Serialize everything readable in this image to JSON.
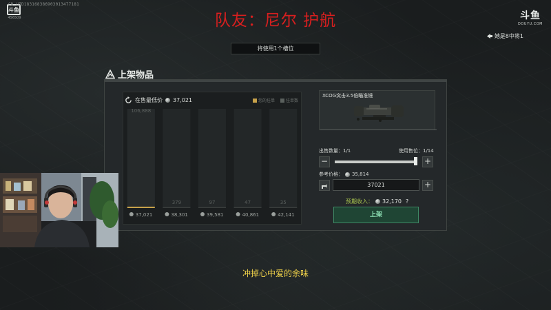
{
  "overlay": {
    "watermark_id": "CN UID183168386903013477181",
    "left_logo_text": "斗鱼",
    "left_logo_number": "456509",
    "team_banner": "队友：尼尔 护航",
    "right_logo_mark": "斗鱼",
    "right_logo_sub": "DOUYU.COM",
    "top_right_note": "她是8中将1",
    "subtitle": "冲掉心中爱的余味"
  },
  "game": {
    "slot_notice": "将使用1个槽位",
    "dialog_title": "上架物品",
    "chart": {
      "header_label": "在售最低价",
      "header_price": "37,021",
      "legend_1": "您的挂单",
      "legend_2": "挂单数",
      "colors": {
        "highlight": "#c8a24a",
        "bar": "#232728",
        "legend_1": "#c8a24a",
        "legend_2": "#5a605d"
      }
    },
    "item": {
      "name": "XCOG突击3.5倍瞄准镜"
    },
    "sell_qty_label": "出售数量：1/1",
    "slots_used_label": "使用售位：1/14",
    "ref_price_label": "参考价格：",
    "ref_price_value": "35,814",
    "price_input_value": "37021",
    "expected_income_label": "预期收入：",
    "expected_income_value": "32,170",
    "help_mark": "?",
    "list_button": "上架",
    "decrease_glyph": "−",
    "increase_glyph": "+",
    "qty_fraction": 1.0
  },
  "chart_data": {
    "type": "bar",
    "categories": [
      "37,021",
      "38,301",
      "39,581",
      "40,861",
      "42,141"
    ],
    "values": [
      106888,
      379,
      97,
      47,
      35
    ],
    "data_labels": [
      "106,888",
      "379",
      "97",
      "47",
      "35"
    ],
    "title": "",
    "xlabel": "",
    "ylabel": "",
    "ylim": [
      0,
      106888
    ],
    "grid": false,
    "legend": [
      "您的挂单",
      "挂单数"
    ],
    "legend_position": "top-right"
  }
}
